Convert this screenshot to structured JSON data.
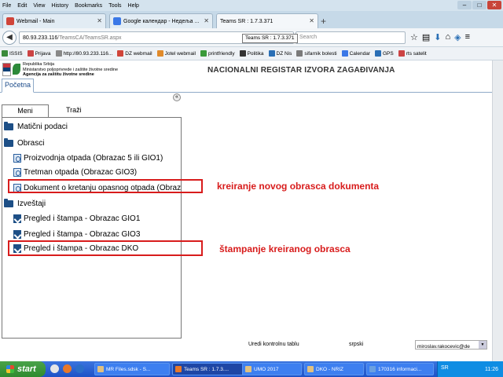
{
  "browser": {
    "menu": [
      "File",
      "Edit",
      "View",
      "History",
      "Bookmarks",
      "Tools",
      "Help"
    ],
    "tabs": [
      {
        "title": "Webmail - Main",
        "fav_color": "#d0453a"
      },
      {
        "title": "Google календар - Недеља ...",
        "fav_color": "#3b78e7"
      },
      {
        "title": "Teams SR : 1.7.3.371",
        "fav_color": "#ffffff"
      }
    ],
    "new_tab": "+",
    "url_host": "80.93.233.116",
    "url_path": "/TeamsCA/TeamsSR.aspx",
    "search_placeholder": "Search",
    "tooltip": "Teams SR : 1.7.3.371",
    "bookmarks": [
      {
        "label": "ISSIS",
        "color": "#3a8a3a"
      },
      {
        "label": "Prijava",
        "color": "#c44"
      },
      {
        "label": "http://80.93.233.116...",
        "color": "#888"
      },
      {
        "label": "DZ webmail",
        "color": "#d0453a"
      },
      {
        "label": "Jotel webmail",
        "color": "#e08a2a"
      },
      {
        "label": "printfriendly",
        "color": "#3a9a3a"
      },
      {
        "label": "Politika",
        "color": "#333"
      },
      {
        "label": "DZ Nis",
        "color": "#2a6fb5"
      },
      {
        "label": "sifarnik bolesti",
        "color": "#7a7a7a"
      },
      {
        "label": "Calendar",
        "color": "#3b78e7"
      },
      {
        "label": "GPS",
        "color": "#2a6fb5"
      },
      {
        "label": "rts satelit",
        "color": "#c44"
      }
    ]
  },
  "header": {
    "ministry_line1": "Republika Srbija",
    "ministry_line2": "Ministarstvo poljoprivrede i zaštite životne sredine",
    "ministry_line3": "Agencija za zaštitu životne sredine",
    "system_name": "NACIONALNI REGISTAR IZVORA ZAGAĐIVANJA"
  },
  "page_tab": "Početna",
  "collapse_glyph": "«",
  "side_tabs": {
    "menu": "Meni",
    "search": "Traži"
  },
  "tree": {
    "master_data": "Matični podaci",
    "forms": "Obrasci",
    "form_items": [
      "Proizvodnja otpada (Obrazac 5 ili GIO1)",
      "Tretman otpada (Obrazac GIO3)",
      "Dokument o kretanju opasnog otpada (Obrazac DKO)"
    ],
    "reports": "Izveštaji",
    "report_items": [
      "Pregled i štampa - Obrazac GIO1",
      "Pregled i štampa - Obrazac GIO3",
      "Pregled i štampa - Obrazac DKO"
    ]
  },
  "annotations": {
    "create": "kreiranje novog obrasca dokumenta",
    "print": "štampanje kreiranog obrasca",
    "color": "#d81c1c"
  },
  "footer": {
    "edit_board": "Uredi kontrolnu tablu",
    "language": "srpski",
    "user": "miroslav.rakocevic@de"
  },
  "taskbar": {
    "start": "start",
    "items": [
      "MR Files.sdsk - S...",
      "Teams SR : 1.7.3....",
      "UMO 2017",
      "DKO - NRIZ",
      "170316 informaci..."
    ],
    "lang": "SR",
    "clock": "11:26"
  },
  "colors": {
    "accent": "#1d4f86",
    "highlight": "#d81c1c",
    "taskbar": "#245edb"
  }
}
